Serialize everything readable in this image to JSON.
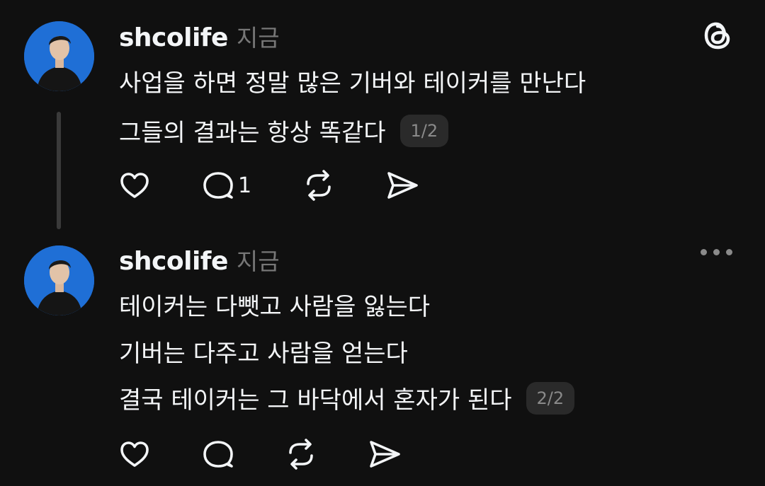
{
  "posts": [
    {
      "username": "shcolife",
      "time": "지금",
      "lines": [
        "사업을 하면 정말 많은 기버와 테이커를 만난다",
        "그들의 결과는 항상 똑같다"
      ],
      "badge": "1/2",
      "reply_count": "1"
    },
    {
      "username": "shcolife",
      "time": "지금",
      "lines": [
        "테이커는 다뺏고 사람을 잃는다",
        "기버는 다주고 사람을 얻는다",
        "결국 테이커는 그 바닥에서 혼자가 된다"
      ],
      "badge": "2/2"
    }
  ],
  "icons": {
    "like": "heart-icon",
    "reply": "comment-icon",
    "repost": "repost-icon",
    "share": "send-icon",
    "logo": "threads-logo-icon",
    "more": "more-icon"
  },
  "colors": {
    "background": "#101010",
    "text": "#f3f5f7",
    "muted": "#777777"
  }
}
